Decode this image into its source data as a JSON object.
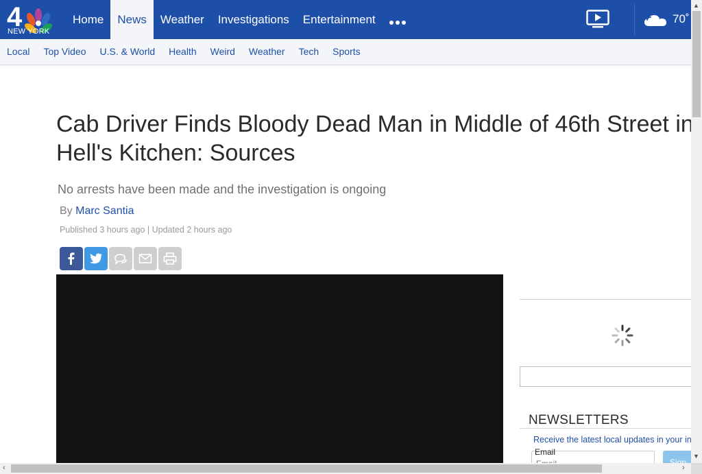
{
  "brand": {
    "logo_text": "NEW YORK",
    "logo_numeral": "4"
  },
  "nav": {
    "items": [
      {
        "label": "Home",
        "active": false
      },
      {
        "label": "News",
        "active": true
      },
      {
        "label": "Weather",
        "active": false
      },
      {
        "label": "Investigations",
        "active": false
      },
      {
        "label": "Entertainment",
        "active": false
      }
    ],
    "more_icon": "more-dots-icon",
    "video_icon": "tv-play-icon",
    "weather_icon": "cloud-icon",
    "temperature": "70˚"
  },
  "subnav": {
    "items": [
      "Local",
      "Top Video",
      "U.S. & World",
      "Health",
      "Weird",
      "Weather",
      "Tech",
      "Sports"
    ]
  },
  "article": {
    "headline_line1": "Cab Driver Finds Bloody Dead Man in Middle of 46th Street in",
    "headline_line2": "Hell's Kitchen: Sources",
    "subheadline": "No arrests have been made and the investigation is ongoing",
    "byline_prefix": "By",
    "author": "Marc Santia",
    "published": "Published 3 hours ago | Updated 2 hours ago"
  },
  "share": {
    "icons": [
      "facebook-icon",
      "twitter-icon",
      "comment-icon",
      "email-icon",
      "print-icon"
    ]
  },
  "sidebar": {
    "newsletters_title": "NEWSLETTERS",
    "newsletters_desc": "Receive the latest local updates in your in",
    "email_label": "Email",
    "email_placeholder": "Email",
    "signup_label": "Sign"
  },
  "colors": {
    "brand_blue": "#1e4fa8",
    "facebook": "#3b5998",
    "twitter": "#4099e3",
    "video_bg": "#131313"
  }
}
